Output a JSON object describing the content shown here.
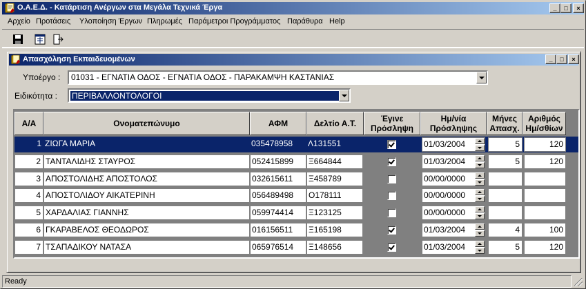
{
  "app": {
    "title": "Ο.Α.Ε.Δ. - Κατάρτιση Ανέργων στα Μεγάλα Τεχνικά Έργα",
    "icon": "app-book-icon"
  },
  "menu": [
    "Αρχείο",
    "Προτάσεις",
    "Υλοποίηση Έργων",
    "Πληρωμές",
    "Παράμετροι Προγράμματος",
    "Παράθυρα",
    "Help"
  ],
  "toolbar": {
    "buttons": [
      "save-icon",
      "window-icon",
      "exit-icon"
    ]
  },
  "child": {
    "title": "Απασχόληση Εκπαιδευομένων",
    "subproject_label": "Υποέργο :",
    "subproject_value": "01031 - ΕΓΝΑΤΙΑ ΟΔΟΣ - ΕΓΝΑΤΙΑ ΟΔΟΣ - ΠΑΡΑΚΑΜΨΗ ΚΑΣΤΑΝΙΑΣ",
    "specialty_label": "Ειδικότητα :",
    "specialty_value": "ΠΕΡΙΒΑΛΛΟΝΤΟΛΟΓΟΙ"
  },
  "grid": {
    "headers": {
      "aa": "Α/Α",
      "name": "Ονοματεπώνυμο",
      "afm": "ΑΦΜ",
      "id": "Δελτίο Α.Τ.",
      "hired_1": "Έγινε",
      "hired_2": "Πρόσληψη",
      "date_1": "Ημ/νία",
      "date_2": "Πρόσληψης",
      "months_1": "Μήνες",
      "months_2": "Απασχ.",
      "days_1": "Αριθμός",
      "days_2": "Ημ/σθίων"
    },
    "rows": [
      {
        "aa": "1",
        "name": "ΖΙΩΓΑ  ΜΑΡΙΑ",
        "afm": "035478958",
        "id": "Λ131551",
        "hired": true,
        "date": "01/03/2004",
        "months": "5",
        "days": "120"
      },
      {
        "aa": "2",
        "name": "ΤΑΝΤΑΛΙΔΗΣ ΣΤΑΥΡΟΣ",
        "afm": "052415899",
        "id": "Ξ664844",
        "hired": true,
        "date": "01/03/2004",
        "months": "5",
        "days": "120"
      },
      {
        "aa": "3",
        "name": "ΑΠΟΣΤΟΛΙΔΗΣ ΑΠΟΣΤΟΛΟΣ",
        "afm": "032615611",
        "id": "Ξ458789",
        "hired": false,
        "date": "00/00/0000",
        "months": "",
        "days": ""
      },
      {
        "aa": "4",
        "name": "ΑΠΟΣΤΟΛΙΔΟΥ ΑΙΚΑΤΕΡΙΝΗ",
        "afm": "056489498",
        "id": "Ο178111",
        "hired": false,
        "date": "00/00/0000",
        "months": "",
        "days": ""
      },
      {
        "aa": "5",
        "name": "ΧΑΡΔΑΛΙΑΣ ΓΙΑΝΝΗΣ",
        "afm": "059974414",
        "id": "Ξ123125",
        "hired": false,
        "date": "00/00/0000",
        "months": "",
        "days": ""
      },
      {
        "aa": "6",
        "name": "ΓΚΑΡΑΒΕΛΟΣ ΘΕΟΔΩΡΟΣ",
        "afm": "016156511",
        "id": "Ξ165198",
        "hired": true,
        "date": "01/03/2004",
        "months": "4",
        "days": "100"
      },
      {
        "aa": "7",
        "name": "ΤΣΑΠΑΔΙΚΟΥ ΝΑΤΑΣΑ",
        "afm": "065976514",
        "id": "Ξ148656",
        "hired": true,
        "date": "01/03/2004",
        "months": "5",
        "days": "120"
      }
    ]
  },
  "status": {
    "text": "Ready"
  },
  "colors": {
    "titlebar": "#0a246a",
    "selection": "#0a246a",
    "face": "#d4d0c8"
  }
}
